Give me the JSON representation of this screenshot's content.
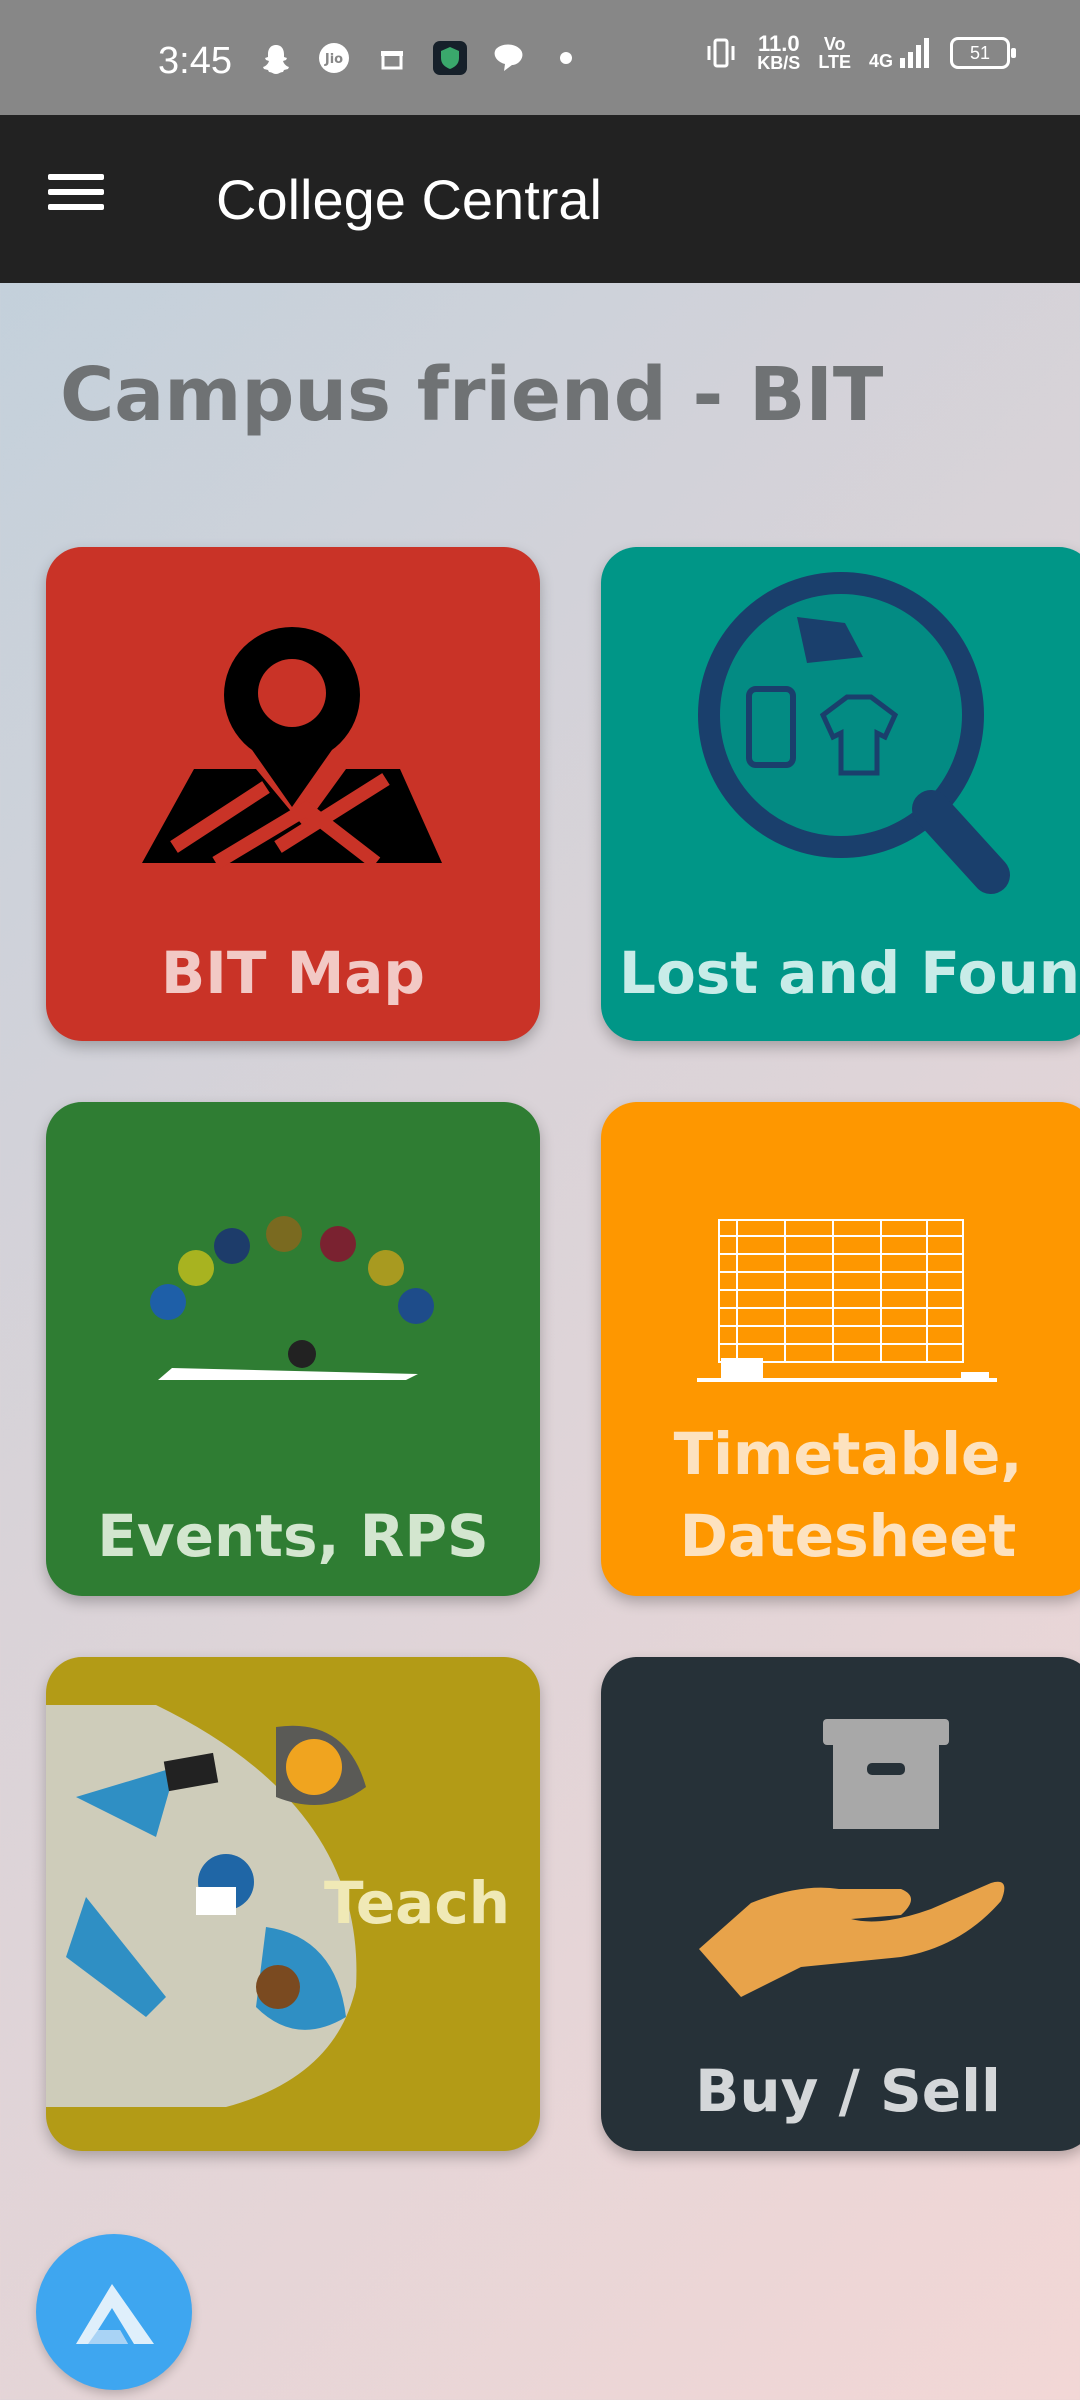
{
  "status": {
    "time": "3:45",
    "speed_value": "11.0",
    "speed_unit": "KB/S",
    "volte_top": "Vo",
    "volte_bottom": "LTE",
    "network": "4G",
    "battery": "51"
  },
  "app_bar": {
    "title": "College Central"
  },
  "page": {
    "title": "Campus friend - BIT"
  },
  "tiles": [
    {
      "label": "BIT Map",
      "color": "#c93327"
    },
    {
      "label": "Lost and Found",
      "color": "#009687"
    },
    {
      "label": "Events, RPS",
      "color": "#2f7d33"
    },
    {
      "label_line1": "Timetable,",
      "label_line2": "Datesheet",
      "color": "#fe9700"
    },
    {
      "label": "Teach",
      "color": "#b39b16"
    },
    {
      "label": "Buy / Sell",
      "color": "#263138"
    }
  ],
  "fab": {
    "icon": "app-logo-icon",
    "color": "#3ea6f0"
  }
}
